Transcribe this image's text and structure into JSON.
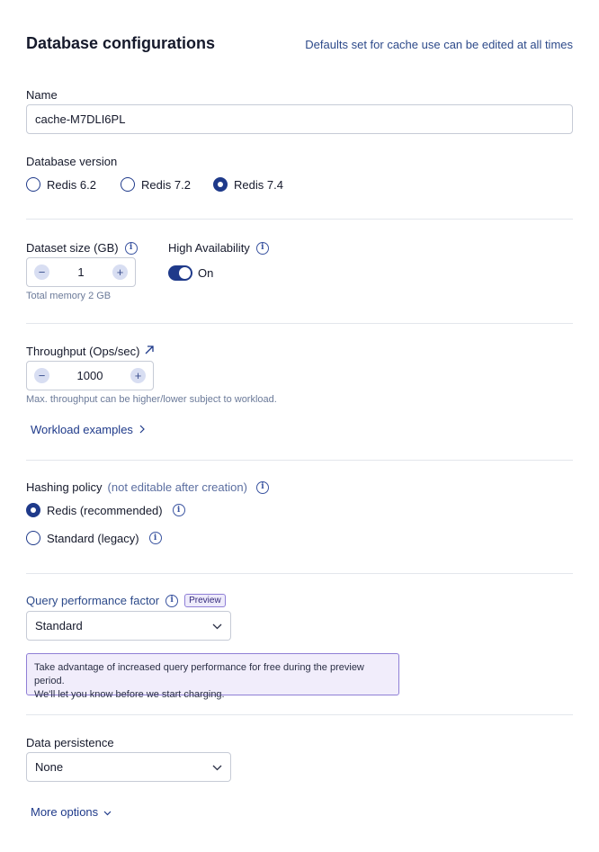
{
  "header": {
    "title": "Database configurations",
    "hint": "Defaults set for cache use can be edited at all times"
  },
  "name_field": {
    "label": "Name",
    "value": "cache-M7DLI6PL"
  },
  "db_version": {
    "label": "Database version",
    "options": [
      {
        "label": "Redis 6.2",
        "selected": false
      },
      {
        "label": "Redis 7.2",
        "selected": false
      },
      {
        "label": "Redis 7.4",
        "selected": true
      }
    ]
  },
  "dataset_size": {
    "label": "Dataset size (GB)",
    "value": "1",
    "helper": "Total memory 2 GB"
  },
  "high_availability": {
    "label": "High Availability",
    "state_label": "On",
    "enabled": true
  },
  "throughput": {
    "label": "Throughput (Ops/sec)",
    "value": "1000",
    "helper": "Max. throughput can be higher/lower subject to workload.",
    "link_label": "Workload examples"
  },
  "hashing_policy": {
    "label": "Hashing policy",
    "note": "(not editable after creation)",
    "options": [
      {
        "label": "Redis (recommended)",
        "selected": true
      },
      {
        "label": "Standard (legacy)",
        "selected": false
      }
    ]
  },
  "query_performance": {
    "label": "Query performance factor",
    "badge": "Preview",
    "selected": "Standard",
    "notice_line1": "Take advantage of increased query performance for free during the preview period.",
    "notice_line2": "We'll let you know before we start charging."
  },
  "data_persistence": {
    "label": "Data persistence",
    "selected": "None"
  },
  "more_options": {
    "label": "More options"
  },
  "icons": {
    "info": "info-icon",
    "minus": "minus-icon",
    "plus": "plus-icon",
    "external": "external-link-icon",
    "chevron_right": "chevron-right-icon",
    "chevron_down": "chevron-down-icon"
  },
  "colors": {
    "accent": "#1f3a8a",
    "preview_border": "#8f7fd6",
    "preview_bg": "#f1edfb"
  }
}
